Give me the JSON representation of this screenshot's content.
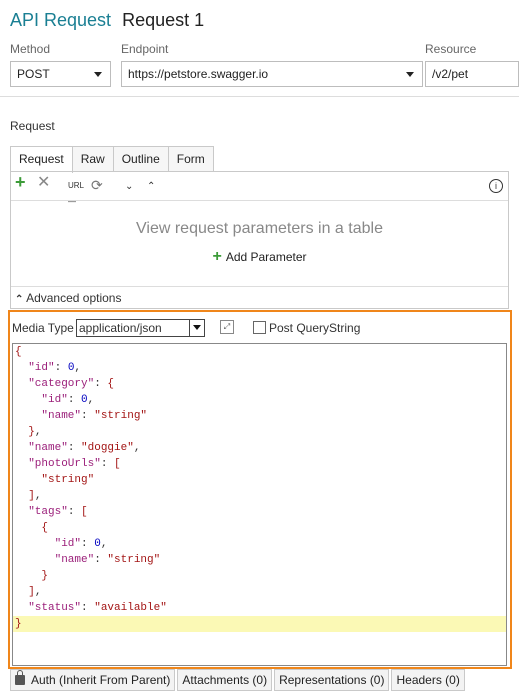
{
  "header": {
    "app_title": "API Request",
    "request_name": "Request 1"
  },
  "method": {
    "label": "Method",
    "value": "POST"
  },
  "endpoint": {
    "label": "Endpoint",
    "value": "https://petstore.swagger.io"
  },
  "resource": {
    "label": "Resource",
    "value": "/v2/pet"
  },
  "request_section": {
    "label": "Request"
  },
  "tabs": [
    {
      "label": "Request"
    },
    {
      "label": "Raw"
    },
    {
      "label": "Outline"
    },
    {
      "label": "Form"
    }
  ],
  "params": {
    "empty_message": "View request parameters in a table",
    "add_label": "Add Parameter"
  },
  "advanced": {
    "label": "Advanced options"
  },
  "media": {
    "label": "Media Type",
    "value": "application/json",
    "post_querystring_label": "Post QueryString",
    "post_querystring_checked": false
  },
  "body_lines": [
    "{",
    "  \"id\": 0,",
    "  \"category\": {",
    "    \"id\": 0,",
    "    \"name\": \"string\"",
    "  },",
    "  \"name\": \"doggie\",",
    "  \"photoUrls\": [",
    "    \"string\"",
    "  ],",
    "  \"tags\": [",
    "    {",
    "      \"id\": 0,",
    "      \"name\": \"string\"",
    "    }",
    "  ],",
    "  \"status\": \"available\"",
    "}"
  ],
  "bottom_tabs": [
    {
      "label": "Auth (Inherit From Parent)"
    },
    {
      "label": "Attachments (0)"
    },
    {
      "label": "Representations (0)"
    },
    {
      "label": "Headers (0)"
    }
  ],
  "colors": {
    "accent": "#1a7f93",
    "highlight_border": "#f0861a",
    "key": "#9b1f7a",
    "string": "#a31515",
    "number": "#0000c0"
  }
}
